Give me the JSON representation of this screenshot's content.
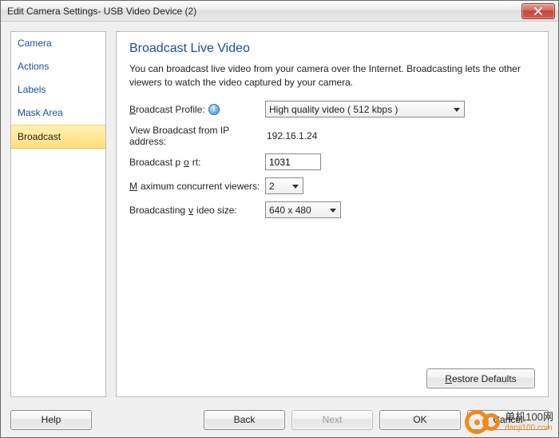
{
  "window": {
    "title": "Edit Camera Settings- USB Video Device (2)"
  },
  "sidebar": {
    "items": [
      {
        "label": "Camera"
      },
      {
        "label": "Actions"
      },
      {
        "label": "Labels"
      },
      {
        "label": "Mask Area"
      },
      {
        "label": "Broadcast"
      }
    ],
    "active_index": 4
  },
  "page": {
    "title": "Broadcast Live Video",
    "description": "You can broadcast live video from your camera over the Internet. Broadcasting lets the other viewers to watch the video captured by your camera."
  },
  "form": {
    "profile": {
      "label_prefix": "B",
      "label_rest": "roadcast Profile:",
      "selected": "High quality video ( 512 kbps )"
    },
    "ip": {
      "label": "View Broadcast from IP address:",
      "value": "192.16.1.24"
    },
    "port": {
      "label_prefix": "Broadcast p",
      "label_u": "o",
      "label_rest": "rt:",
      "value": "1031"
    },
    "viewers": {
      "label_u": "M",
      "label_rest": "aximum concurrent viewers:",
      "selected": "2"
    },
    "size": {
      "label_prefix": "Broadcasting ",
      "label_u": "v",
      "label_rest": "ideo size:",
      "selected": "640 x 480"
    }
  },
  "buttons": {
    "restore": "Restore Defaults",
    "help": "Help",
    "back": "Back",
    "next": "Next",
    "ok": "OK",
    "cancel": "Cancel"
  },
  "watermark": {
    "line1": "单机100网",
    "line2": "danji100.com"
  }
}
